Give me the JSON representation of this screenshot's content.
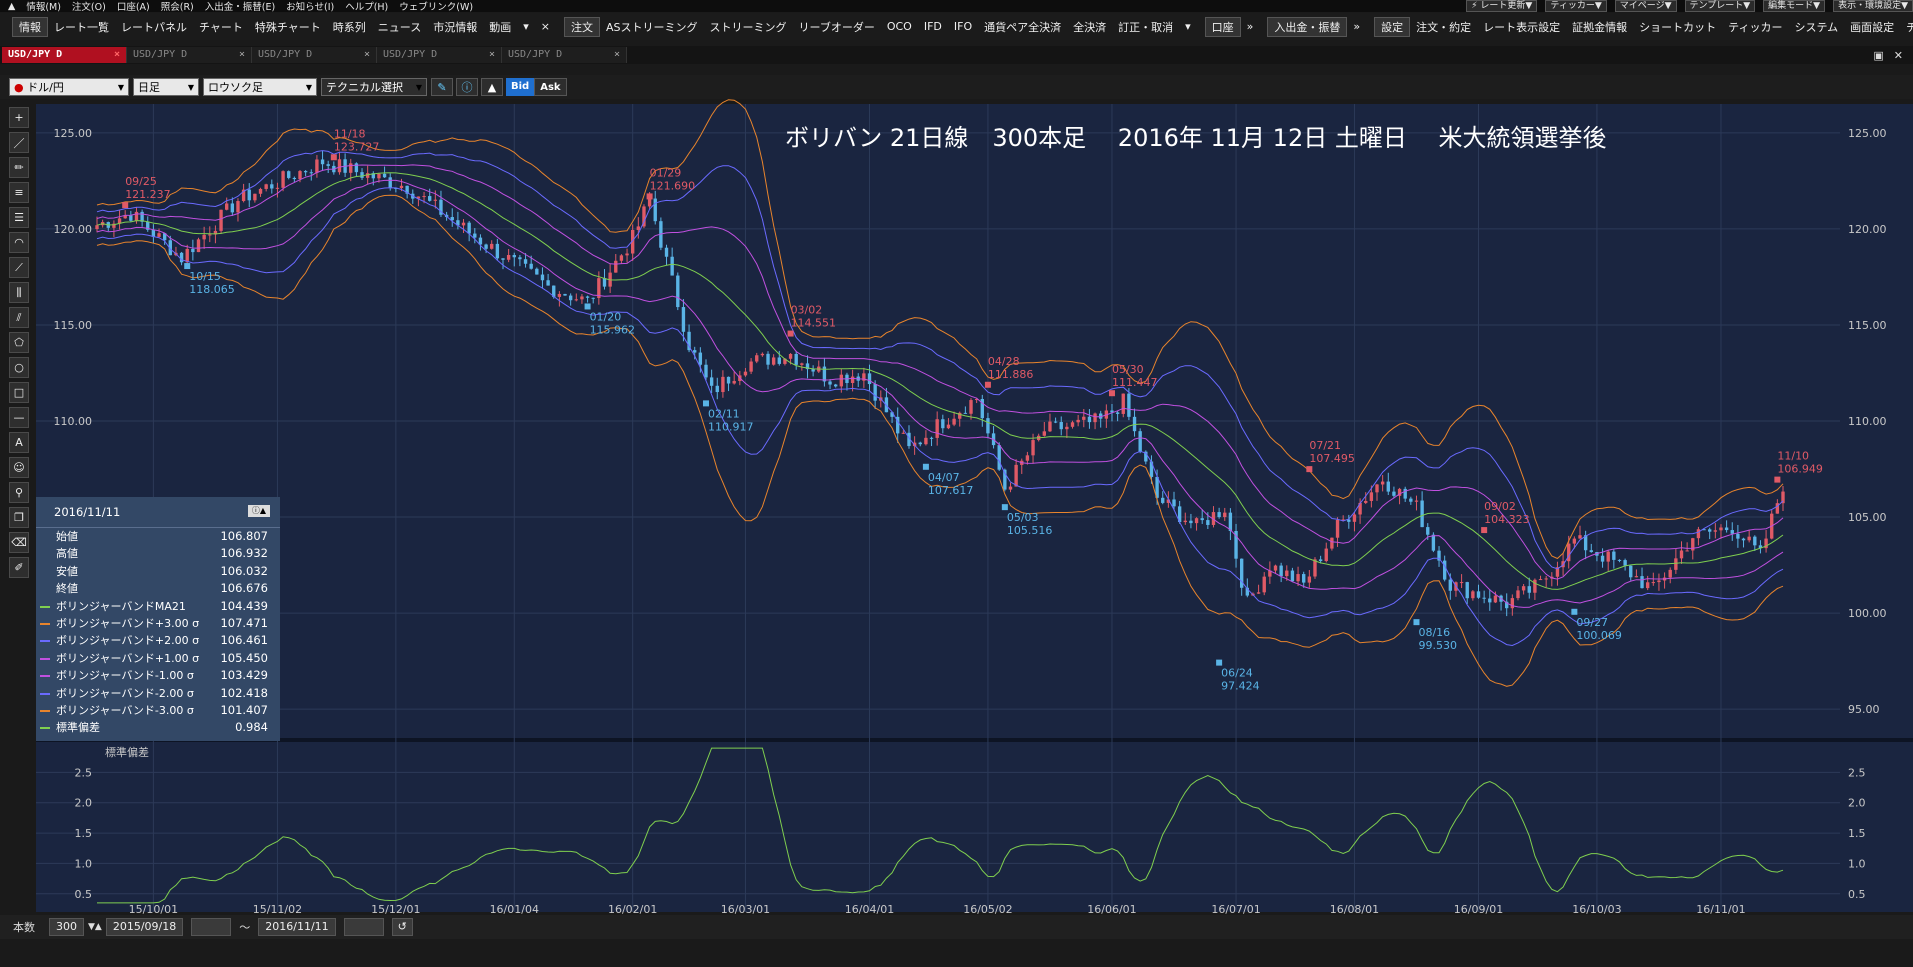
{
  "menubar": {
    "items": [
      "情報(M)",
      "注文(O)",
      "口座(A)",
      "照会(R)",
      "入出金・振替(E)",
      "お知らせ(I)",
      "ヘルプ(H)",
      "ウェブリンク(W)"
    ],
    "right": [
      "⚡ レート更新▼",
      "ティッカー▼",
      "マイページ▼",
      "テンプレート▼",
      "編集モード▼",
      "表示・環境設定▼"
    ]
  },
  "toolbar": {
    "info": "情報",
    "items": [
      "レート一覧",
      "レートパネル",
      "チャート",
      "特殊チャート",
      "時系列",
      "ニュース",
      "市況情報",
      "動画"
    ],
    "order": "注文",
    "order_items": [
      "ASストリーミング",
      "ストリーミング",
      "リーブオーダー",
      "OCO",
      "IFD",
      "IFO",
      "通貨ペア全決済",
      "全決済",
      "訂正・取消"
    ],
    "account": "口座",
    "deposit": "入出金・振替",
    "settings": "設定",
    "settings_items": [
      "注文・約定",
      "レート表示設定",
      "証拠金情報",
      "ショートカット",
      "ティッカー",
      "システム",
      "画面設定",
      "チャート"
    ]
  },
  "tabs": [
    {
      "label": "USD/JPY D",
      "active": true
    },
    {
      "label": "USD/JPY D",
      "active": false
    },
    {
      "label": "USD/JPY D",
      "active": false
    },
    {
      "label": "USD/JPY D",
      "active": false
    },
    {
      "label": "USD/JPY D",
      "active": false
    }
  ],
  "controls": {
    "pair": "ドル/円",
    "timeframe": "日足",
    "charttype": "ロウソク足",
    "technical": "テクニカル選択",
    "bid": "Bid",
    "ask": "Ask"
  },
  "tools": [
    "plus",
    "line",
    "ruler",
    "hlines",
    "multi-lines",
    "arc",
    "fan",
    "vlines",
    "channel",
    "pentagon",
    "circle",
    "square",
    "hline",
    "text",
    "stamp",
    "pin",
    "layers",
    "eraser",
    "highlighter"
  ],
  "chart_title": "ボリバン 21日線　300本足　 2016年 11月 12日 土曜日　 米大統領選挙後",
  "price_axis": [
    "125.00",
    "120.00",
    "115.00",
    "110.00",
    "105.00",
    "100.00",
    "95.00"
  ],
  "sub_axis": [
    "2.5",
    "2.0",
    "1.5",
    "1.0",
    "0.5"
  ],
  "sub_label": "標準偏差",
  "date_axis": [
    "15/10/01",
    "15/11/02",
    "15/12/01",
    "16/01/04",
    "16/02/01",
    "16/03/01",
    "16/04/01",
    "16/05/02",
    "16/06/01",
    "16/07/01",
    "16/08/01",
    "16/09/01",
    "16/10/03",
    "16/11/01"
  ],
  "annotations": [
    {
      "date": "09/25",
      "price": "121.237",
      "type": "high"
    },
    {
      "date": "10/15",
      "price": "118.065",
      "type": "low"
    },
    {
      "date": "11/18",
      "price": "123.727",
      "type": "high"
    },
    {
      "date": "01/20",
      "price": "115.962",
      "type": "low"
    },
    {
      "date": "01/29",
      "price": "121.690",
      "type": "high"
    },
    {
      "date": "02/11",
      "price": "110.917",
      "type": "low"
    },
    {
      "date": "03/02",
      "price": "114.551",
      "type": "high"
    },
    {
      "date": "04/07",
      "price": "107.617",
      "type": "low"
    },
    {
      "date": "04/28",
      "price": "111.886",
      "type": "high"
    },
    {
      "date": "05/03",
      "price": "105.516",
      "type": "low"
    },
    {
      "date": "05/30",
      "price": "111.447",
      "type": "high"
    },
    {
      "date": "06/24",
      "price": "97.424",
      "type": "low"
    },
    {
      "date": "07/21",
      "price": "107.495",
      "type": "high"
    },
    {
      "date": "08/16",
      "price": "99.530",
      "type": "low"
    },
    {
      "date": "09/02",
      "price": "104.323",
      "type": "high"
    },
    {
      "date": "09/27",
      "price": "100.069",
      "type": "low"
    },
    {
      "date": "11/10",
      "price": "106.949",
      "type": "high"
    }
  ],
  "info_panel": {
    "date": "2016/11/11",
    "rows": [
      {
        "label": "始値",
        "value": "106.807",
        "color": ""
      },
      {
        "label": "高値",
        "value": "106.932",
        "color": ""
      },
      {
        "label": "安値",
        "value": "106.032",
        "color": ""
      },
      {
        "label": "終値",
        "value": "106.676",
        "color": ""
      },
      {
        "label": "ボリンジャーバンドMA21",
        "value": "104.439",
        "color": "#7fcf4f"
      },
      {
        "label": "ボリンジャーバンド+3.00 σ",
        "value": "107.471",
        "color": "#e8842c"
      },
      {
        "label": "ボリンジャーバンド+2.00 σ",
        "value": "106.461",
        "color": "#6a6aff"
      },
      {
        "label": "ボリンジャーバンド+1.00 σ",
        "value": "105.450",
        "color": "#c050e0"
      },
      {
        "label": "ボリンジャーバンド-1.00 σ",
        "value": "103.429",
        "color": "#c050e0"
      },
      {
        "label": "ボリンジャーバンド-2.00 σ",
        "value": "102.418",
        "color": "#6a6aff"
      },
      {
        "label": "ボリンジャーバンド-3.00 σ",
        "value": "101.407",
        "color": "#e8842c"
      },
      {
        "label": "標準偏差",
        "value": "0.984",
        "color": "#7fcf4f"
      }
    ]
  },
  "bottom": {
    "bars_label": "本数",
    "bars_value": "300",
    "from": "2015/09/18",
    "tilde": "〜",
    "to": "2016/11/11"
  },
  "colors": {
    "background": "#1a2540",
    "up": "#e05a66",
    "down": "#5ab4e6",
    "ma": "#7fcf4f",
    "sigma1": "#c050e0",
    "sigma2": "#6a6aff",
    "sigma3": "#e8842c",
    "high_label": "#e05a66",
    "low_label": "#5ab4e6"
  }
}
